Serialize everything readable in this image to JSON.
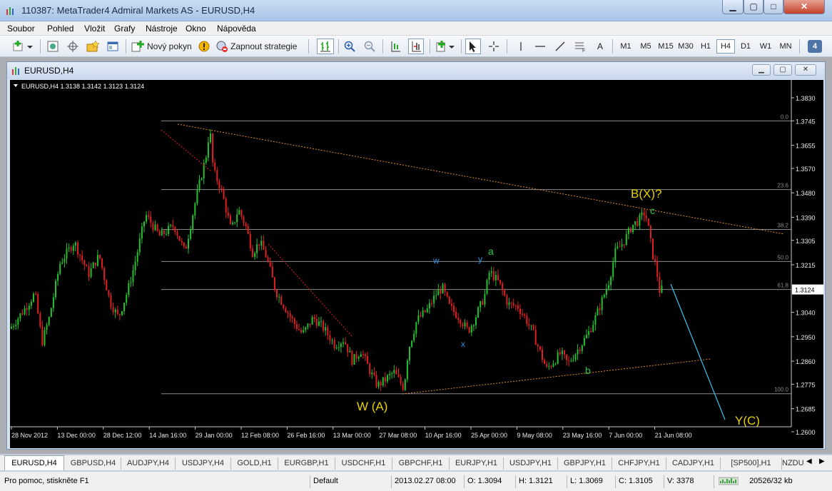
{
  "window": {
    "title": "110387: MetaTrader4 Admiral Markets AS - EURUSD,H4"
  },
  "menu": [
    "Soubor",
    "Pohled",
    "Vložit",
    "Grafy",
    "Nástroje",
    "Okno",
    "Nápověda"
  ],
  "toolbar": {
    "new_order": "Nový pokyn",
    "autotrading": "Zapnout strategie",
    "text_tool": "A",
    "timeframes": [
      "M1",
      "M5",
      "M15",
      "M30",
      "H1",
      "H4",
      "D1",
      "W1",
      "MN"
    ],
    "active_timeframe": "H4",
    "badge": "4"
  },
  "chart_window": {
    "title": "EURUSD,H4",
    "info": "EURUSD,H4  1.3138 1.3142 1.3123 1.3124"
  },
  "chart_data": {
    "type": "candlestick",
    "symbol": "EURUSD",
    "timeframe": "H4",
    "ohlc": [
      1.3138,
      1.3142,
      1.3123,
      1.3124
    ],
    "current_price": "1.3124",
    "y_ticks": [
      "1.3830",
      "1.3745",
      "1.3655",
      "1.3570",
      "1.3480",
      "1.3390",
      "1.3305",
      "1.3215",
      "1.3124",
      "1.3040",
      "1.2950",
      "1.2860",
      "1.2775",
      "1.2685",
      "1.2600"
    ],
    "x_ticks": [
      "28 Nov 2012",
      "13 Dec 00:00",
      "28 Dec 12:00",
      "14 Jan 16:00",
      "29 Jan 00:00",
      "12 Feb 08:00",
      "26 Feb 16:00",
      "13 Mar 00:00",
      "27 Mar 08:00",
      "10 Apr 16:00",
      "25 Apr 00:00",
      "9 May 08:00",
      "23 May 16:00",
      "7 Jun 00:00",
      "21 Jun 08:00"
    ],
    "fib_levels": [
      {
        "label": "0.0",
        "price": 1.3745
      },
      {
        "label": "23.6",
        "price": 1.3492
      },
      {
        "label": "38.2",
        "price": 1.3345
      },
      {
        "label": "50.0",
        "price": 1.3227
      },
      {
        "label": "61.8",
        "price": 1.3124
      },
      {
        "label": "100.0",
        "price": 1.274
      }
    ],
    "price_path": [
      [
        0,
        1.298
      ],
      [
        20,
        1.305
      ],
      [
        35,
        1.311
      ],
      [
        45,
        1.293
      ],
      [
        55,
        1.302
      ],
      [
        70,
        1.322
      ],
      [
        90,
        1.33
      ],
      [
        110,
        1.318
      ],
      [
        125,
        1.325
      ],
      [
        140,
        1.308
      ],
      [
        152,
        1.302
      ],
      [
        165,
        1.312
      ],
      [
        175,
        1.322
      ],
      [
        190,
        1.34
      ],
      [
        210,
        1.332
      ],
      [
        230,
        1.336
      ],
      [
        245,
        1.326
      ],
      [
        260,
        1.345
      ],
      [
        275,
        1.362
      ],
      [
        280,
        1.372
      ],
      [
        285,
        1.356
      ],
      [
        295,
        1.35
      ],
      [
        300,
        1.345
      ],
      [
        310,
        1.334
      ],
      [
        320,
        1.342
      ],
      [
        330,
        1.336
      ],
      [
        340,
        1.326
      ],
      [
        350,
        1.33
      ],
      [
        360,
        1.324
      ],
      [
        372,
        1.312
      ],
      [
        385,
        1.306
      ],
      [
        398,
        1.3
      ],
      [
        410,
        1.296
      ],
      [
        425,
        1.302
      ],
      [
        440,
        1.298
      ],
      [
        455,
        1.292
      ],
      [
        468,
        1.294
      ],
      [
        480,
        1.286
      ],
      [
        492,
        1.29
      ],
      [
        505,
        1.282
      ],
      [
        515,
        1.277
      ],
      [
        525,
        1.279
      ],
      [
        538,
        1.282
      ],
      [
        552,
        1.276
      ],
      [
        558,
        1.29
      ],
      [
        570,
        1.301
      ],
      [
        585,
        1.305
      ],
      [
        598,
        1.311
      ],
      [
        606,
        1.313
      ],
      [
        616,
        1.306
      ],
      [
        630,
        1.302
      ],
      [
        642,
        1.297
      ],
      [
        652,
        1.302
      ],
      [
        665,
        1.31
      ],
      [
        672,
        1.319
      ],
      [
        685,
        1.315
      ],
      [
        698,
        1.307
      ],
      [
        712,
        1.306
      ],
      [
        722,
        1.302
      ],
      [
        732,
        1.297
      ],
      [
        742,
        1.29
      ],
      [
        752,
        1.283
      ],
      [
        762,
        1.286
      ],
      [
        772,
        1.289
      ],
      [
        782,
        1.285
      ],
      [
        795,
        1.29
      ],
      [
        810,
        1.296
      ],
      [
        822,
        1.303
      ],
      [
        832,
        1.31
      ],
      [
        840,
        1.316
      ],
      [
        848,
        1.326
      ],
      [
        860,
        1.33
      ],
      [
        872,
        1.336
      ],
      [
        882,
        1.338
      ],
      [
        890,
        1.341
      ],
      [
        896,
        1.333
      ],
      [
        900,
        1.326
      ],
      [
        906,
        1.32
      ],
      [
        910,
        1.312
      ],
      [
        914,
        1.3124
      ]
    ],
    "annotations": [
      {
        "text": "W (A)",
        "color": "#e6d000"
      },
      {
        "text": "B(X)?",
        "color": "#e6d000"
      },
      {
        "text": "Y(C)",
        "color": "#e6d000"
      },
      {
        "text": "a",
        "color": "#22c64a"
      },
      {
        "text": "b",
        "color": "#22c64a"
      },
      {
        "text": "c",
        "color": "#22c64a"
      },
      {
        "text": "w",
        "color": "#2a90e0"
      },
      {
        "text": "x",
        "color": "#2a90e0"
      },
      {
        "text": "y",
        "color": "#2a90e0"
      }
    ],
    "colors": {
      "background": "#000000",
      "bull": "#22c22c",
      "bear": "#e02020",
      "trendline": "#e08a2a",
      "fib": "#8a8a8a",
      "projection": "#36c4ec"
    }
  },
  "tabs": [
    "EURUSD,H4",
    "GBPUSD,H4",
    "AUDJPY,H4",
    "USDJPY,H4",
    "GOLD,H1",
    "EURGBP,H1",
    "USDCHF,H1",
    "GBPCHF,H1",
    "EURJPY,H1",
    "USDJPY,H1",
    "GBPJPY,H1",
    "CHFJPY,H1",
    "CADJPY,H1",
    "[SP500],H1",
    "NZDU"
  ],
  "status": {
    "help": "Pro pomoc, stiskněte F1",
    "profile": "Default",
    "datetime": "2013.02.27 08:00",
    "open": "O: 1.3094",
    "high": "H: 1.3121",
    "low": "L: 1.3069",
    "close": "C: 1.3105",
    "volume": "V: 3378",
    "traffic": "20526/32 kb"
  }
}
